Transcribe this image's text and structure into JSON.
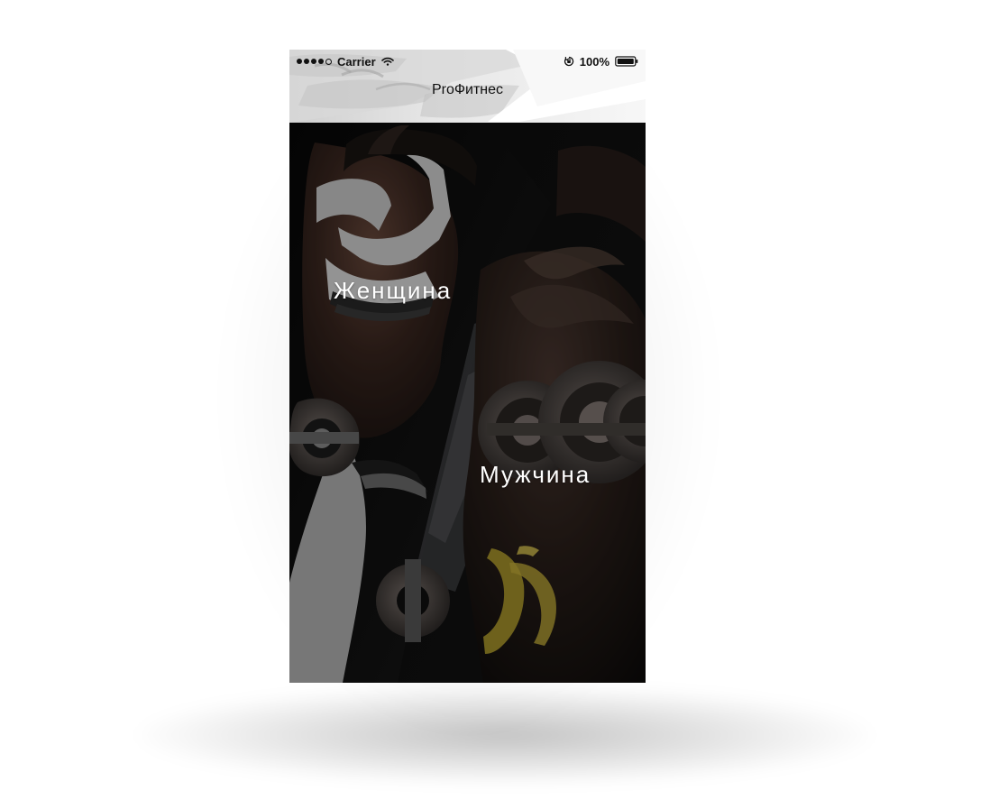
{
  "status_bar": {
    "carrier": "Carrier",
    "battery_percent": "100%",
    "signal_strength": 4,
    "signal_total": 5
  },
  "app": {
    "title": "ProФитнес"
  },
  "hero": {
    "women_label": "Женщина",
    "men_label": "Мужчина"
  },
  "icons": {
    "signal": "signal-icon",
    "wifi": "wifi-icon",
    "rotation_lock": "rotation-lock-icon",
    "battery": "battery-icon"
  },
  "colors": {
    "header_bg": "#ececec",
    "text_dark": "#111111",
    "hero_dark": "#121212",
    "label_white": "#ffffff",
    "accent_yellow": "#bda72f"
  }
}
